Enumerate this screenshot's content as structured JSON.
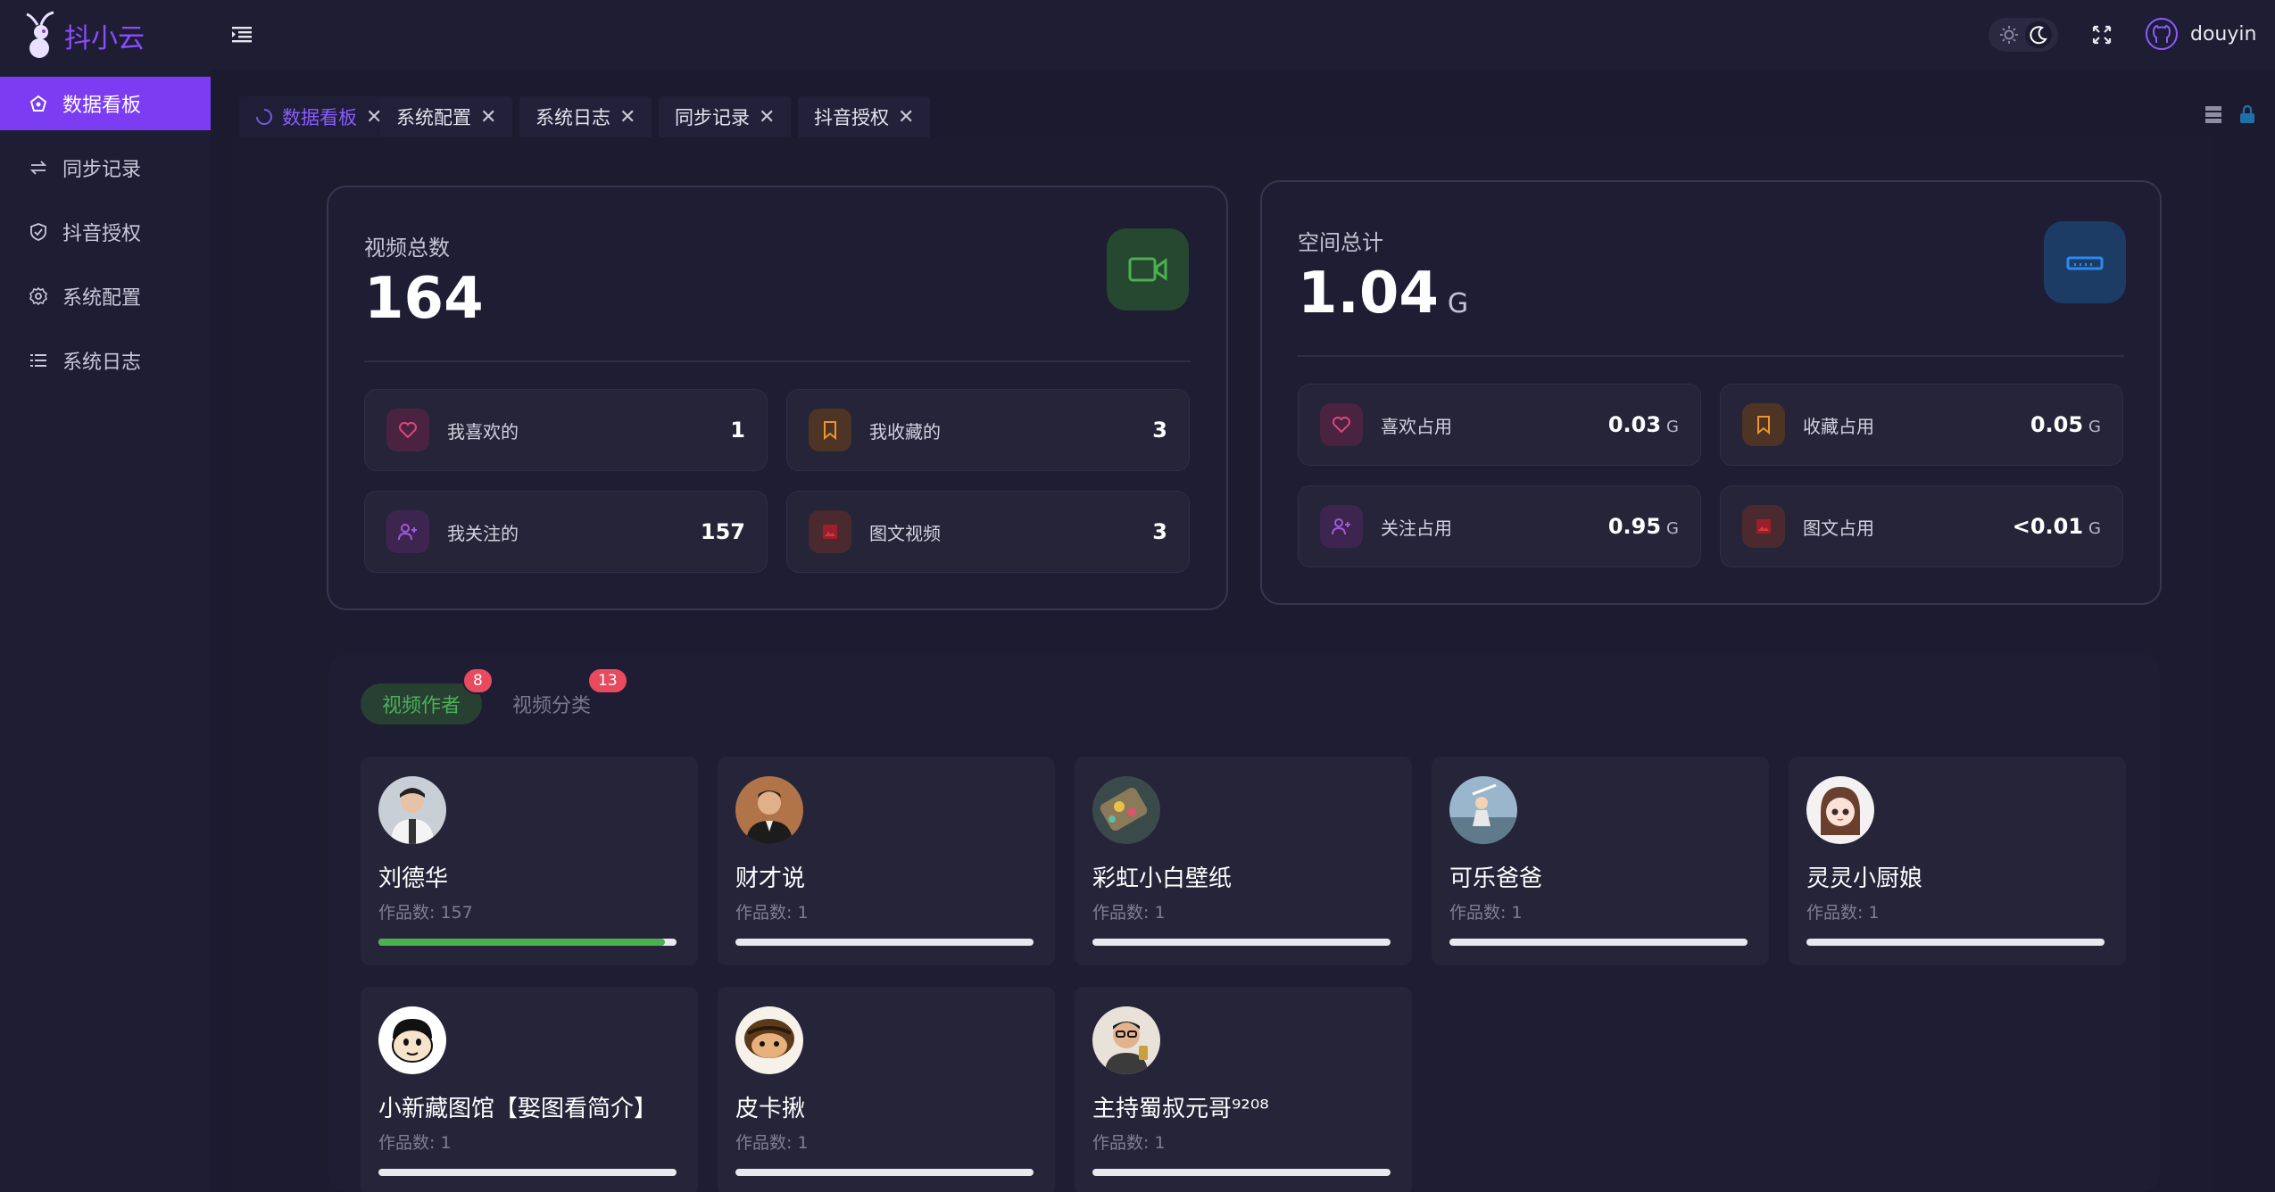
{
  "app": {
    "brand": "抖小云",
    "user_name": "douyin"
  },
  "sidebar": {
    "items": [
      {
        "label": "数据看板",
        "icon": "dashboard-icon",
        "active": true
      },
      {
        "label": "同步记录",
        "icon": "sync-icon",
        "active": false
      },
      {
        "label": "抖音授权",
        "icon": "shield-icon",
        "active": false
      },
      {
        "label": "系统配置",
        "icon": "gear-icon",
        "active": false
      },
      {
        "label": "系统日志",
        "icon": "list-icon",
        "active": false
      }
    ]
  },
  "tabs": [
    {
      "label": "数据看板",
      "active": true
    },
    {
      "label": "系统配置",
      "active": false
    },
    {
      "label": "系统日志",
      "active": false
    },
    {
      "label": "同步记录",
      "active": false
    },
    {
      "label": "抖音授权",
      "active": false
    }
  ],
  "video_card": {
    "title": "视频总数",
    "value": "164",
    "stats": [
      {
        "label": "我喜欢的",
        "value": "1",
        "icon": "heart-icon"
      },
      {
        "label": "我收藏的",
        "value": "3",
        "icon": "bookmark-icon"
      },
      {
        "label": "我关注的",
        "value": "157",
        "icon": "user-plus-icon"
      },
      {
        "label": "图文视频",
        "value": "3",
        "icon": "image-icon"
      }
    ]
  },
  "space_card": {
    "title": "空间总计",
    "value": "1.04",
    "unit": "G",
    "stats": [
      {
        "label": "喜欢占用",
        "value": "0.03",
        "unit": "G",
        "icon": "heart-icon"
      },
      {
        "label": "收藏占用",
        "value": "0.05",
        "unit": "G",
        "icon": "bookmark-icon"
      },
      {
        "label": "关注占用",
        "value": "0.95",
        "unit": "G",
        "icon": "user-plus-icon"
      },
      {
        "label": "图文占用",
        "value": "<0.01",
        "unit": "G",
        "icon": "image-icon"
      }
    ]
  },
  "lower_tabs": [
    {
      "label": "视频作者",
      "badge": "8",
      "active": true
    },
    {
      "label": "视频分类",
      "badge": "13",
      "active": false
    }
  ],
  "authors": [
    {
      "name": "刘德华",
      "count": "作品数: 157",
      "progress": 0.96
    },
    {
      "name": "财才说",
      "count": "作品数: 1",
      "progress": 0
    },
    {
      "name": "彩虹小白壁纸",
      "count": "作品数: 1",
      "progress": 0
    },
    {
      "name": "可乐爸爸",
      "count": "作品数: 1",
      "progress": 0
    },
    {
      "name": "灵灵小厨娘",
      "count": "作品数: 1",
      "progress": 0
    },
    {
      "name": "小新藏图馆【娶图看简介】",
      "count": "作品数: 1",
      "progress": 0
    },
    {
      "name": "皮卡揪",
      "count": "作品数: 1",
      "progress": 0
    },
    {
      "name": "主持蜀叔元哥⁹²⁰⁸",
      "count": "作品数: 1",
      "progress": 0
    }
  ],
  "colors": {
    "accent": "#7b3cf2",
    "success": "#4caf50",
    "badge": "#e84a5f"
  }
}
